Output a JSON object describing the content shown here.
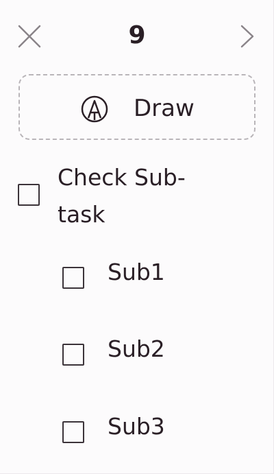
{
  "header": {
    "step_number": "9"
  },
  "draw_button": {
    "label": "Draw"
  },
  "checklist": {
    "main_task": {
      "label_line1": "Check Sub-",
      "label_line2": "task",
      "checked": false
    },
    "subtasks": [
      {
        "label": "Sub1",
        "checked": false
      },
      {
        "label": "Sub2",
        "checked": false
      },
      {
        "label": "Sub3",
        "checked": false
      }
    ]
  },
  "icons": {
    "close": "close-icon",
    "next": "chevron-right-icon",
    "draw": "pencil-circle-icon"
  },
  "colors": {
    "text": "#2a1f26",
    "border_dashed": "#b9b5b9",
    "background": "#fcfbfc"
  }
}
